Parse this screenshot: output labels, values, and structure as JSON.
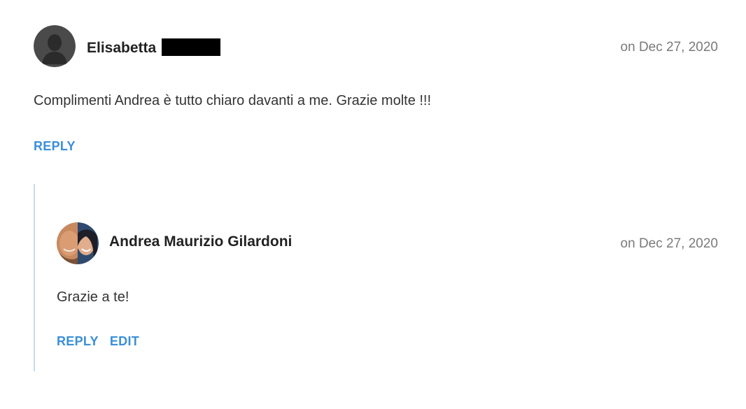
{
  "comments": [
    {
      "author": "Elisabetta",
      "date": "on Dec 27, 2020",
      "text": "Complimenti Andrea è tutto chiaro davanti a me. Grazie molte !!!",
      "actions": [
        "REPLY"
      ]
    },
    {
      "author": "Andrea Maurizio Gilardoni",
      "date": "on Dec 27, 2020",
      "text": "Grazie a te!",
      "actions": [
        "REPLY",
        "EDIT"
      ]
    }
  ],
  "colors": {
    "link": "#3a8fd9",
    "thread_line": "#c9dbe8",
    "date": "#7a7a7a"
  }
}
